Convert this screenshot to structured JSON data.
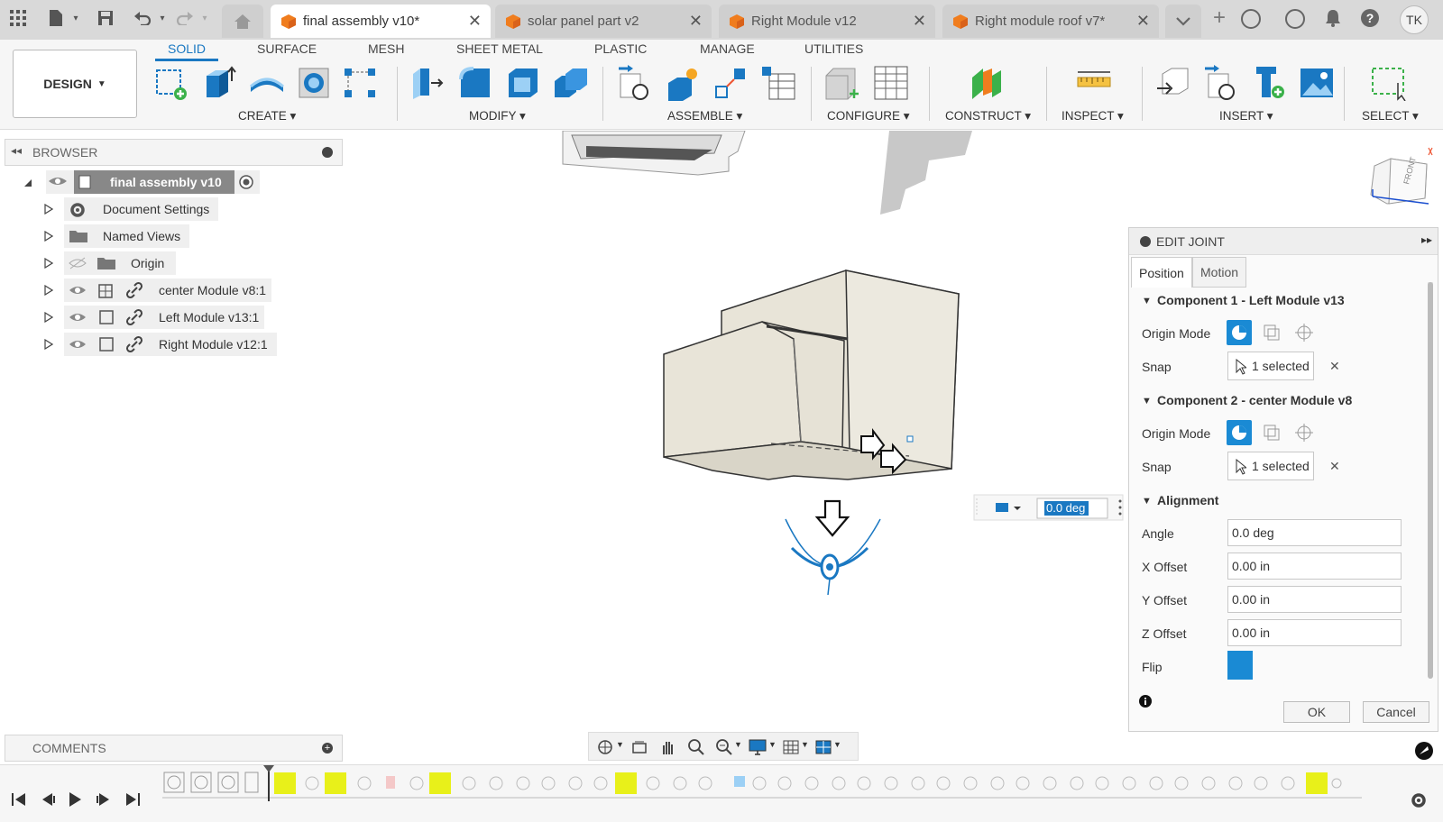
{
  "titlebar": {
    "tabs": [
      {
        "label": "final assembly v10*",
        "active": true
      },
      {
        "label": "solar panel part v2",
        "active": false
      },
      {
        "label": "Right Module v12",
        "active": false
      },
      {
        "label": "Right module roof v7*",
        "active": false
      }
    ],
    "user_initials": "TK"
  },
  "toolbar": {
    "workspace": "DESIGN",
    "tabs": [
      "SOLID",
      "SURFACE",
      "MESH",
      "SHEET METAL",
      "PLASTIC",
      "MANAGE",
      "UTILITIES"
    ],
    "active_tab": "SOLID",
    "groups": [
      "CREATE",
      "MODIFY",
      "ASSEMBLE",
      "CONFIGURE",
      "CONSTRUCT",
      "INSPECT",
      "INSERT",
      "SELECT"
    ]
  },
  "browser": {
    "title": "BROWSER",
    "root": "final assembly v10",
    "items": [
      {
        "label": "Document Settings"
      },
      {
        "label": "Named Views"
      },
      {
        "label": "Origin"
      },
      {
        "label": "center Module v8:1"
      },
      {
        "label": "Left Module v13:1"
      },
      {
        "label": "Right Module v12:1"
      }
    ]
  },
  "viewcube": {
    "label": "FRONT"
  },
  "angle_input": {
    "value": "0.0 deg"
  },
  "edit_joint": {
    "title": "EDIT JOINT",
    "tabs": [
      "Position",
      "Motion"
    ],
    "component1": "Component 1 - Left Module v13",
    "component2": "Component 2 - center Module v8",
    "origin_mode_label": "Origin Mode",
    "snap_label": "Snap",
    "snap1_value": "1 selected",
    "snap2_value": "1 selected",
    "alignment": "Alignment",
    "angle_label": "Angle",
    "angle_value": "0.0 deg",
    "x_offset_label": "X Offset",
    "x_offset_value": "0.00 in",
    "y_offset_label": "Y Offset",
    "y_offset_value": "0.00 in",
    "z_offset_label": "Z Offset",
    "z_offset_value": "0.00 in",
    "flip_label": "Flip",
    "ok_label": "OK",
    "cancel_label": "Cancel"
  },
  "comments": {
    "title": "COMMENTS"
  },
  "colors": {
    "accent": "#1a78c2",
    "model": "#e8e4d8",
    "timeline_highlight": "#e8f01a"
  }
}
